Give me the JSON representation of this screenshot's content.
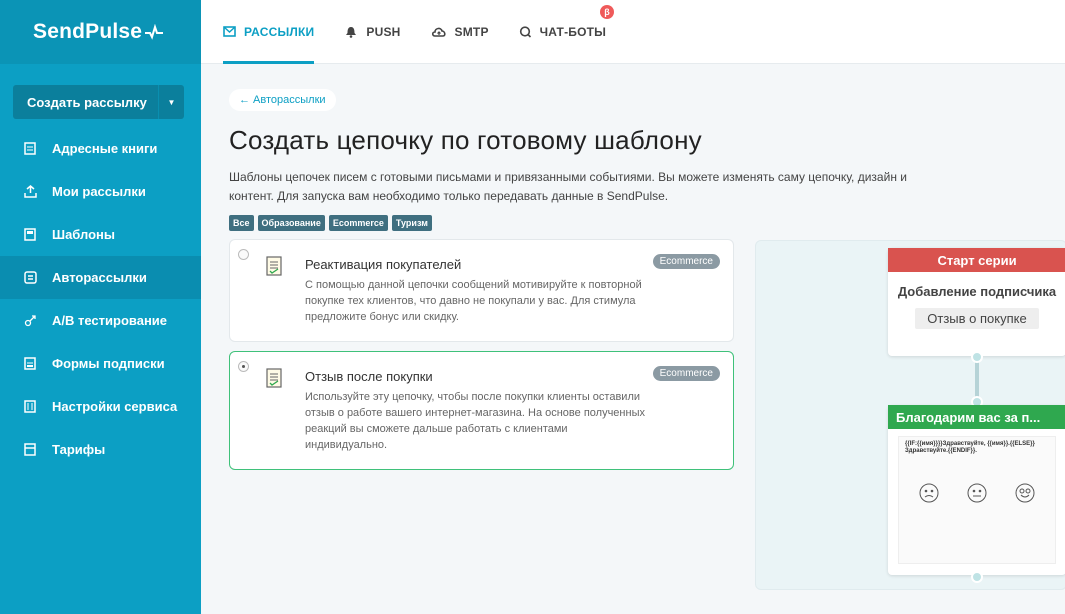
{
  "brand": {
    "name": "SendPulse"
  },
  "sidebar": {
    "create_button": "Создать рассылку",
    "items": [
      {
        "label": "Адресные книги",
        "icon": "address-book-icon"
      },
      {
        "label": "Мои рассылки",
        "icon": "send-icon"
      },
      {
        "label": "Шаблоны",
        "icon": "template-icon"
      },
      {
        "label": "Авторассылки",
        "icon": "autoresponder-icon",
        "active": true
      },
      {
        "label": "A/B тестирование",
        "icon": "ab-test-icon"
      },
      {
        "label": "Формы подписки",
        "icon": "form-icon"
      },
      {
        "label": "Настройки сервиса",
        "icon": "settings-icon"
      },
      {
        "label": "Тарифы",
        "icon": "pricing-icon"
      }
    ]
  },
  "topnav": {
    "tabs": [
      {
        "label": "РАССЫЛКИ",
        "icon": "envelope-icon",
        "active": true
      },
      {
        "label": "PUSH",
        "icon": "bell-icon"
      },
      {
        "label": "SMTP",
        "icon": "cloud-icon"
      },
      {
        "label": "ЧАТ-БОТЫ",
        "icon": "chat-icon",
        "badge": "β"
      }
    ]
  },
  "main": {
    "back_link": "← Авторассылки",
    "title": "Создать цепочку по готовому шаблону",
    "description": "Шаблоны цепочек писем с готовыми письмами и привязанными событиями. Вы можете изменять саму цепочку, дизайн и контент. Для запуска вам необходимо только передавать данные в SendPulse.",
    "filters": [
      "Все",
      "Образование",
      "Ecommerce",
      "Туризм"
    ],
    "templates": [
      {
        "title": "Реактивация покупателей",
        "text": "С помощью данной цепочки сообщений мотивируйте к повторной покупке тех клиентов, что давно не покупали у вас. Для стимула предложите бонус или скидку.",
        "badge": "Ecommerce",
        "selected": false
      },
      {
        "title": "Отзыв после покупки",
        "text": "Используйте эту цепочку, чтобы после покупки клиенты оставили отзыв о работе вашего интернет-магазина. На основе полученных реакций вы сможете дальше работать с клиентами индивидуально.",
        "badge": "Ecommerce",
        "selected": true
      }
    ]
  },
  "preview": {
    "start_title": "Старт серии",
    "start_subtitle": "Добавление подписчика",
    "start_tag": "Отзыв о покупке",
    "email_title": "Благодарим вас за п...",
    "email_snippet": "{{IF:{{имя}}}}Здравствуйте, {{имя}}.{{ELSE}}Здравствуйте.{{ENDIF}}."
  },
  "colors": {
    "sidebar": "#0c9fc4",
    "accent": "#0c9fc4",
    "start": "#d9534f",
    "email": "#2fa84f",
    "selected_border": "#3fc17a"
  }
}
